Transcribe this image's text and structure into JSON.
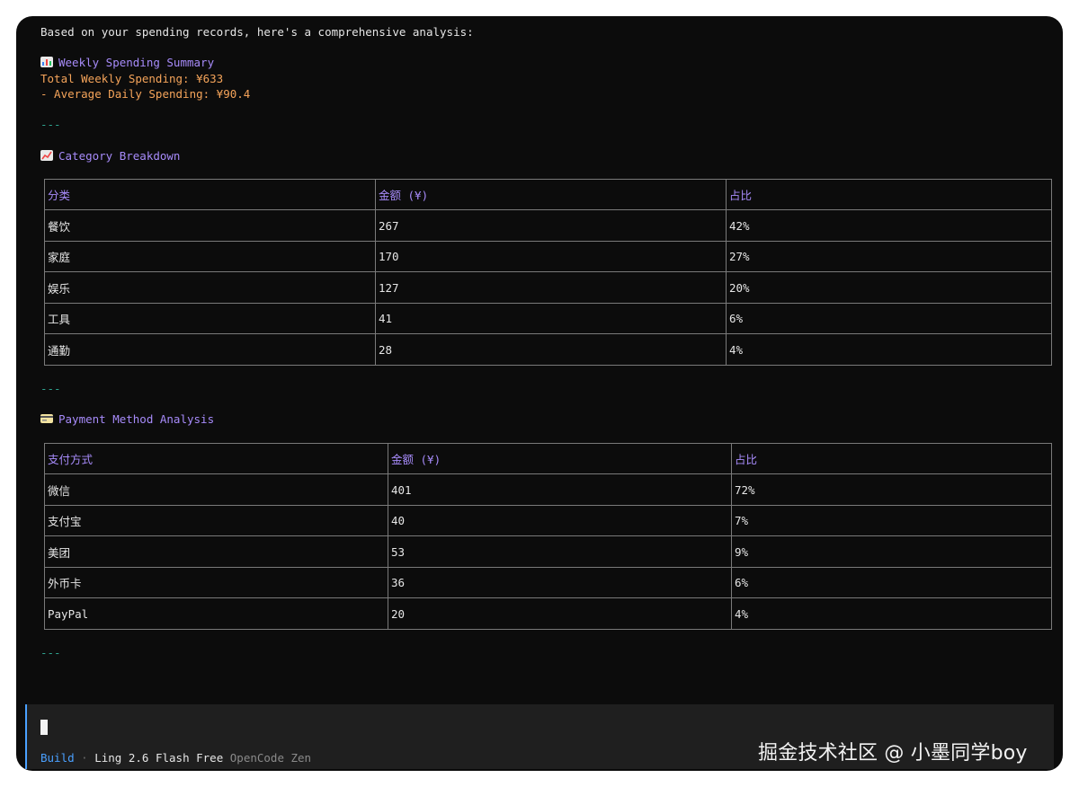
{
  "intro": "Based on your spending records, here's a comprehensive analysis:",
  "weekly": {
    "icon": "bar-chart-emoji",
    "title": "Weekly Spending Summary",
    "total": "Total Weekly Spending: ¥633",
    "average": "- Average Daily Spending: ¥90.4"
  },
  "separator": "---",
  "category": {
    "icon": "chart-increasing-emoji",
    "title": "Category Breakdown",
    "headers": [
      "分类",
      "金额 (¥)",
      "占比"
    ],
    "rows": [
      [
        "餐饮",
        "267",
        "42%"
      ],
      [
        "家庭",
        "170",
        "27%"
      ],
      [
        "娱乐",
        "127",
        "20%"
      ],
      [
        "工具",
        "41",
        "6%"
      ],
      [
        "通勤",
        "28",
        "4%"
      ]
    ]
  },
  "payment": {
    "icon": "credit-card-emoji",
    "title": "Payment Method Analysis",
    "headers": [
      "支付方式",
      "金额 (¥)",
      "占比"
    ],
    "rows": [
      [
        "微信",
        "401",
        "72%"
      ],
      [
        "支付宝",
        "40",
        "7%"
      ],
      [
        "美团",
        "53",
        "9%"
      ],
      [
        "外币卡",
        "36",
        "6%"
      ],
      [
        "PayPal",
        "20",
        "4%"
      ]
    ]
  },
  "status": {
    "mode": "Build",
    "dot": "·",
    "model": "Ling 2.6 Flash Free",
    "provider": "OpenCode Zen"
  },
  "watermark": "掘金技术社区 @ 小墨同学boy",
  "colors": {
    "background": "#0c0c0c",
    "heading": "#a78bfa",
    "highlight": "#f5a45a",
    "separator": "#2fa38f",
    "accent": "#4aa0ff"
  }
}
